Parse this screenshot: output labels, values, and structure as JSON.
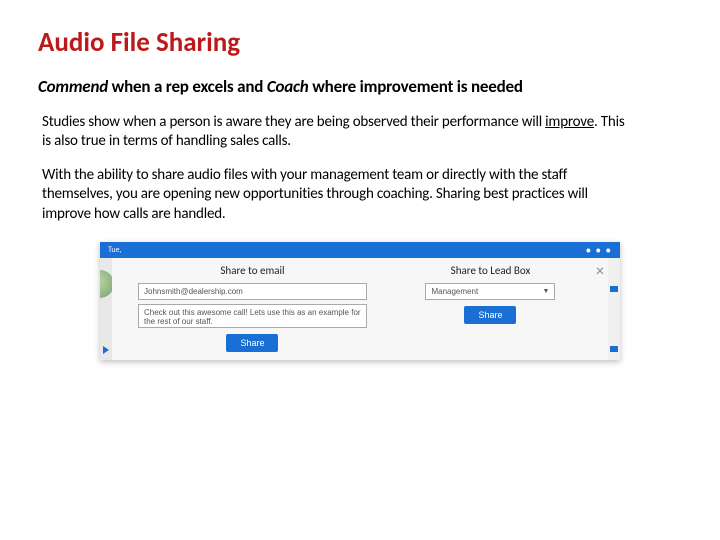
{
  "title": "Audio File Sharing",
  "subtitle": {
    "lead1": "Commend",
    "mid1": " when a rep excels and ",
    "lead2": "Coach",
    "tail": " where improvement is needed"
  },
  "para1": {
    "a": "Studies show when a person is aware they are being observed their performance will ",
    "u": "improve",
    "b": ". This is also true in terms of handling sales calls."
  },
  "para2": "With the ability to share audio files with your management team or directly with the staff themselves, you are opening new opportunities through coaching. Sharing best practices will improve how calls are handled.",
  "ui": {
    "topbar_date": "Tue,",
    "topbar_dots": "• • •",
    "close": "×",
    "email_panel": {
      "title": "Share to email",
      "email_value": "Johnsmith@dealership.com",
      "message_value": "Check out this awesome call! Lets use this as an example for the rest of our staff.",
      "button": "Share"
    },
    "leadbox_panel": {
      "title": "Share to Lead Box",
      "select_value": "Management",
      "button": "Share"
    }
  }
}
